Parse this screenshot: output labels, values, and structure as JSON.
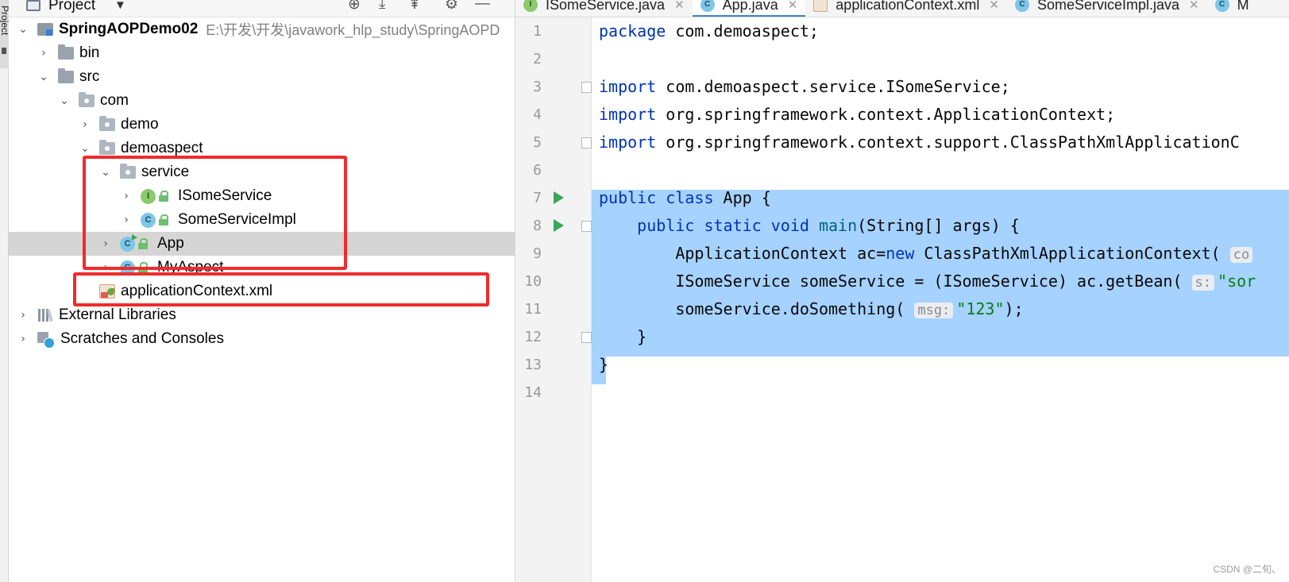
{
  "sidebar_strip": {
    "label": "Project"
  },
  "project_panel": {
    "title": "Project",
    "tree": [
      {
        "label": "SpringAOPDemo02",
        "path": "E:\\开发\\开发\\javawork_hlp_study\\SpringAOPD",
        "depth": 0,
        "expanded": true,
        "icon": "module-icon"
      },
      {
        "label": "bin",
        "depth": 1,
        "expanded": false,
        "icon": "folder-icon"
      },
      {
        "label": "src",
        "depth": 1,
        "expanded": true,
        "icon": "folder-icon"
      },
      {
        "label": "com",
        "depth": 2,
        "expanded": true,
        "icon": "package-icon"
      },
      {
        "label": "demo",
        "depth": 3,
        "expanded": false,
        "icon": "package-icon"
      },
      {
        "label": "demoaspect",
        "depth": 3,
        "expanded": true,
        "icon": "package-icon"
      },
      {
        "label": "service",
        "depth": 4,
        "expanded": true,
        "icon": "package-icon"
      },
      {
        "label": "ISomeService",
        "depth": 5,
        "expanded": false,
        "icon": "interface-icon",
        "badge": "I"
      },
      {
        "label": "SomeServiceImpl",
        "depth": 5,
        "expanded": false,
        "icon": "class-icon",
        "badge": "C"
      },
      {
        "label": "App",
        "depth": 4,
        "expanded": false,
        "icon": "runnable-class-icon",
        "badge": "C",
        "selected": true
      },
      {
        "label": "MyAspect",
        "depth": 4,
        "expanded": false,
        "icon": "class-icon",
        "badge": "C"
      },
      {
        "label": "applicationContext.xml",
        "depth": 3,
        "expanded": null,
        "icon": "spring-xml-icon"
      },
      {
        "label": "External Libraries",
        "depth": 0,
        "expanded": false,
        "icon": "libraries-icon"
      },
      {
        "label": "Scratches and Consoles",
        "depth": 0,
        "expanded": false,
        "icon": "scratches-icon"
      }
    ]
  },
  "editor": {
    "tabs": [
      {
        "label": "ISomeService.java",
        "icon": "I",
        "active": false
      },
      {
        "label": "App.java",
        "icon": "C",
        "active": true
      },
      {
        "label": "applicationContext.xml",
        "icon": "X",
        "active": false
      },
      {
        "label": "SomeServiceImpl.java",
        "icon": "C",
        "active": false
      },
      {
        "label": "M",
        "icon": "C",
        "active": false
      }
    ],
    "lines": [
      {
        "n": "1",
        "code": "package com.demoaspect;"
      },
      {
        "n": "2",
        "code": ""
      },
      {
        "n": "3",
        "code": "import com.demoaspect.service.ISomeService;"
      },
      {
        "n": "4",
        "code": "import org.springframework.context.ApplicationContext;"
      },
      {
        "n": "5",
        "code": "import org.springframework.context.support.ClassPathXmlApplicationC"
      },
      {
        "n": "6",
        "code": ""
      },
      {
        "n": "7",
        "code": "public class App {"
      },
      {
        "n": "8",
        "code": "    public static void main(String[] args) {"
      },
      {
        "n": "9",
        "code": "        ApplicationContext ac=new ClassPathXmlApplicationContext( co"
      },
      {
        "n": "10",
        "code": "        ISomeService someService = (ISomeService) ac.getBean( s: \"sor"
      },
      {
        "n": "11",
        "code": "        someService.doSomething( msg: \"123\");"
      },
      {
        "n": "12",
        "code": "    }"
      },
      {
        "n": "13",
        "code": "}"
      },
      {
        "n": "14",
        "code": ""
      }
    ],
    "hints": {
      "line9": "co",
      "line10": "s:",
      "line11": "msg:"
    },
    "strings": {
      "line10": "\"sor",
      "line11": "\"123\""
    }
  },
  "watermark": "CSDN @二旬、",
  "colors": {
    "selection": "#a6d2ff",
    "keyword": "#0033b3",
    "string": "#067d17",
    "annotation_box": "#ef2b2b",
    "active_tab_underline": "#4083c9"
  }
}
